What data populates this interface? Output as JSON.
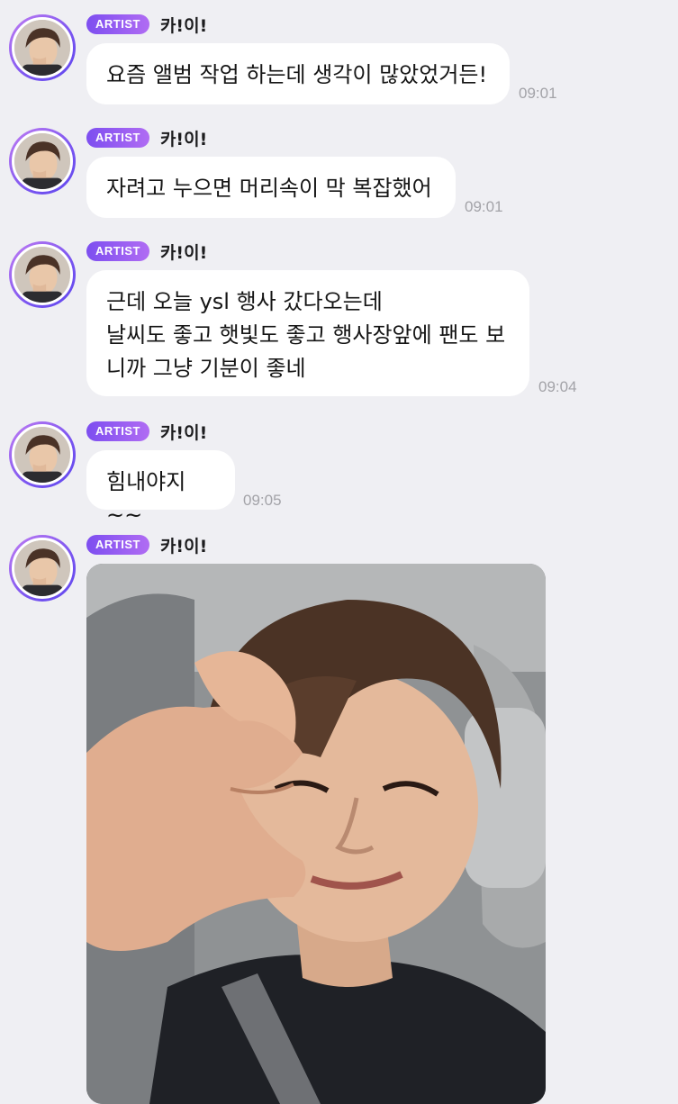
{
  "messages": [
    {
      "badge": "ARTIST",
      "sender": "카!이!",
      "text": "요즘 앨범 작업 하는데 생각이 많았었거든!",
      "time": "09:01"
    },
    {
      "badge": "ARTIST",
      "sender": "카!이!",
      "text": "자려고 누으면 머리속이 막 복잡했어",
      "time": "09:01"
    },
    {
      "badge": "ARTIST",
      "sender": "카!이!",
      "text": "근데 오늘 ysl 행사 갔다오는데\n날씨도 좋고 햇빛도 좋고 행사장앞에 팬도 보\n니까 그냥 기분이 좋네",
      "time": "09:04"
    },
    {
      "badge": "ARTIST",
      "sender": "카!이!",
      "text": "힘내야지~~",
      "time": "09:05"
    },
    {
      "badge": "ARTIST",
      "sender": "카!이!",
      "attachment": "selfie-photo"
    }
  ],
  "colors": {
    "background": "#efeff3",
    "bubble": "#ffffff",
    "badge_gradient_start": "#7d4ef0",
    "badge_gradient_end": "#b06cf3",
    "timestamp": "#a3a3a8"
  },
  "icons": {
    "avatar": "artist-avatar"
  }
}
